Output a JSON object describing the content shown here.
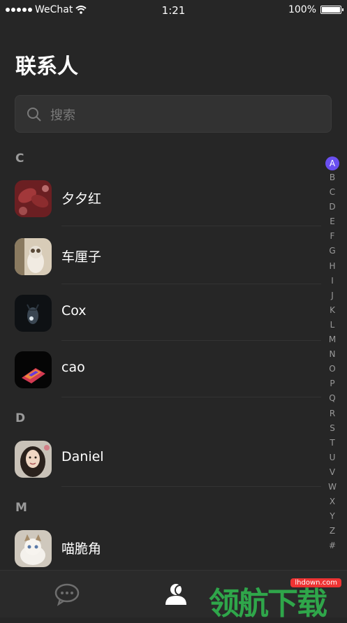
{
  "status_bar": {
    "carrier": "WeChat",
    "time": "1:21",
    "battery": "100%"
  },
  "page_title": "联系人",
  "search": {
    "placeholder": "搜索"
  },
  "sections": [
    {
      "letter": "C",
      "contacts": [
        {
          "name": "夕夕红",
          "avatar": "red-leaves-photo"
        },
        {
          "name": "车厘子",
          "avatar": "cat-photo"
        },
        {
          "name": "Cox",
          "avatar": "dark-cat-photo"
        },
        {
          "name": "cao",
          "avatar": "colorful-light-photo"
        }
      ]
    },
    {
      "letter": "D",
      "contacts": [
        {
          "name": "Daniel",
          "avatar": "portrait-photo"
        }
      ]
    },
    {
      "letter": "M",
      "contacts": [
        {
          "name": "喵脆角",
          "avatar": "kitten-photo"
        }
      ]
    }
  ],
  "alpha_index": [
    "A",
    "B",
    "C",
    "D",
    "E",
    "F",
    "G",
    "H",
    "I",
    "J",
    "K",
    "L",
    "M",
    "N",
    "O",
    "P",
    "Q",
    "R",
    "S",
    "T",
    "U",
    "V",
    "W",
    "X",
    "Y",
    "Z",
    "#"
  ],
  "alpha_index_active": "A",
  "tab_bar": {
    "items": [
      {
        "icon": "chat-bubble-icon"
      },
      {
        "icon": "contacts-icon",
        "active": true
      }
    ]
  },
  "watermark": {
    "text": "领航下载",
    "badge": "lhdown.com"
  },
  "colors": {
    "background": "#262626",
    "accent": "#6a4ff0"
  }
}
